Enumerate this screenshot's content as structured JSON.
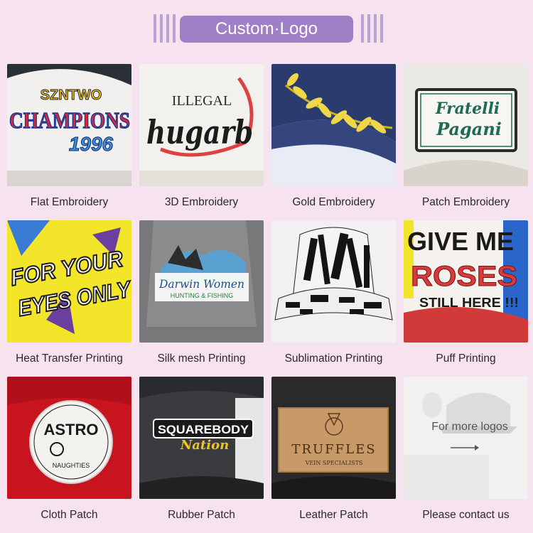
{
  "header": {
    "title": "Custom·Logo"
  },
  "items": [
    {
      "label": "Flat Embroidery",
      "art": {
        "line1": "SZNTWO",
        "line2": "CHAMPIONS",
        "line3": "1996"
      }
    },
    {
      "label": "3D Embroidery",
      "art": {
        "line1": "ILLEGAL",
        "line2": "hugarb"
      }
    },
    {
      "label": "Gold Embroidery"
    },
    {
      "label": "Patch Embroidery",
      "art": {
        "line1": "Fratelli",
        "line2": "Pagani"
      }
    },
    {
      "label": "Heat Transfer Printing",
      "art": {
        "line1": "FOR YOUR",
        "line2": "EYES ONLY"
      }
    },
    {
      "label": "Silk mesh Printing",
      "art": {
        "line1": "Darwin Women",
        "line2": "HUNTING & FISHING"
      }
    },
    {
      "label": "Sublimation Printing"
    },
    {
      "label": "Puff Printing",
      "art": {
        "line1": "GIVE ME",
        "line2": "ROSES",
        "line3": "STILL HERE !!!"
      }
    },
    {
      "label": "Cloth Patch",
      "art": {
        "line1": "ASTRO",
        "line2": "NAUGHTIES"
      }
    },
    {
      "label": "Rubber Patch",
      "art": {
        "line1": "SQUAREBODY",
        "line2": "Nation"
      }
    },
    {
      "label": "Leather Patch",
      "art": {
        "line1": "TRUFFLES",
        "line2": "VEIN SPECIALISTS"
      }
    },
    {
      "label": "Please contact us",
      "art": {
        "line1": "For more logos"
      }
    }
  ]
}
